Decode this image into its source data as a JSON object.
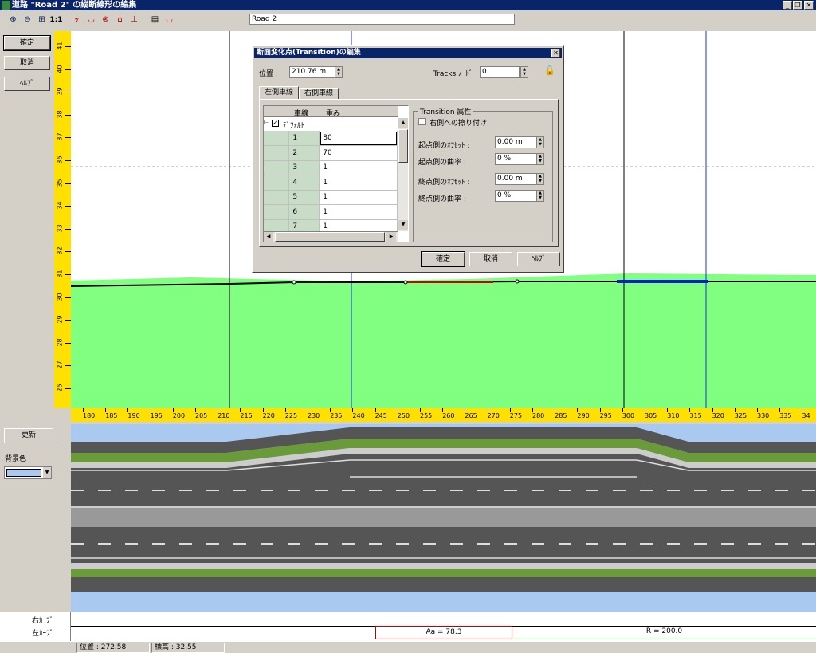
{
  "window": {
    "title": "道路 \"Road 2\" の縦断線形の編集",
    "road_name": "Road 2"
  },
  "toolbar": {
    "icons": [
      "zoom-in-icon",
      "zoom-out-icon",
      "fit-icon",
      "one-to-one-icon",
      "profile-icon-1",
      "profile-icon-2",
      "profile-icon-3",
      "profile-icon-4",
      "profile-icon-5",
      "page-icon",
      "profile-icon-6"
    ],
    "one_to_one": "1:1"
  },
  "left_panel": {
    "ok": "確定",
    "cancel": "取消",
    "help": "ﾍﾙﾌﾟ"
  },
  "lower_panel": {
    "update": "更新",
    "bg_color_label": "背景色",
    "bg_color": "#a9c9f0"
  },
  "vruler": {
    "ticks": [
      "41",
      "40",
      "39",
      "38",
      "37",
      "36",
      "35",
      "34",
      "33",
      "32",
      "31",
      "30",
      "29",
      "28",
      "27",
      "26"
    ]
  },
  "hruler": {
    "ticks": [
      "180",
      "185",
      "190",
      "195",
      "200",
      "205",
      "210",
      "215",
      "220",
      "225",
      "230",
      "235",
      "240",
      "245",
      "250",
      "255",
      "260",
      "265",
      "270",
      "275",
      "280",
      "285",
      "290",
      "295",
      "300",
      "305",
      "310",
      "315",
      "320",
      "325",
      "330",
      "335",
      "34"
    ]
  },
  "curves": {
    "right_label": "右ｶｰﾌﾞ",
    "left_label": "左ｶｰﾌﾞ",
    "aa": "Aa = 78.3",
    "r": "R = 200.0"
  },
  "status": {
    "position": "位置 : 272.58",
    "elevation": "標高 : 32.55"
  },
  "dialog": {
    "title": "断面変化点(Transition)の編集",
    "position_label": "位置 :",
    "position_value": "210.76 m",
    "tracks_label": "Tracks ﾉｰﾄﾞ",
    "tracks_value": "0",
    "tabs": [
      "左側車線",
      "右側車線"
    ],
    "grid": {
      "headers": [
        "車線",
        "重み"
      ],
      "default_label": "ﾃﾞﾌｫﾙﾄ",
      "rows": [
        {
          "lane": "1",
          "weight": "80"
        },
        {
          "lane": "2",
          "weight": "70"
        },
        {
          "lane": "3",
          "weight": "1"
        },
        {
          "lane": "4",
          "weight": "1"
        },
        {
          "lane": "5",
          "weight": "1"
        },
        {
          "lane": "6",
          "weight": "1"
        },
        {
          "lane": "7",
          "weight": "1"
        }
      ]
    },
    "group_title": "Transition 属性",
    "snap_right_label": "右側への擦り付け",
    "start_offset_label": "起点側のｵﾌｾｯﾄ :",
    "start_offset_value": "0.00 m",
    "start_curv_label": "起点側の曲率 :",
    "start_curv_value": "0 %",
    "end_offset_label": "終点側のｵﾌｾｯﾄ :",
    "end_offset_value": "0.00 m",
    "end_curv_label": "終点側の曲率 :",
    "end_curv_value": "0 %",
    "ok": "確定",
    "cancel": "取消",
    "help": "ﾍﾙﾌﾟ"
  }
}
